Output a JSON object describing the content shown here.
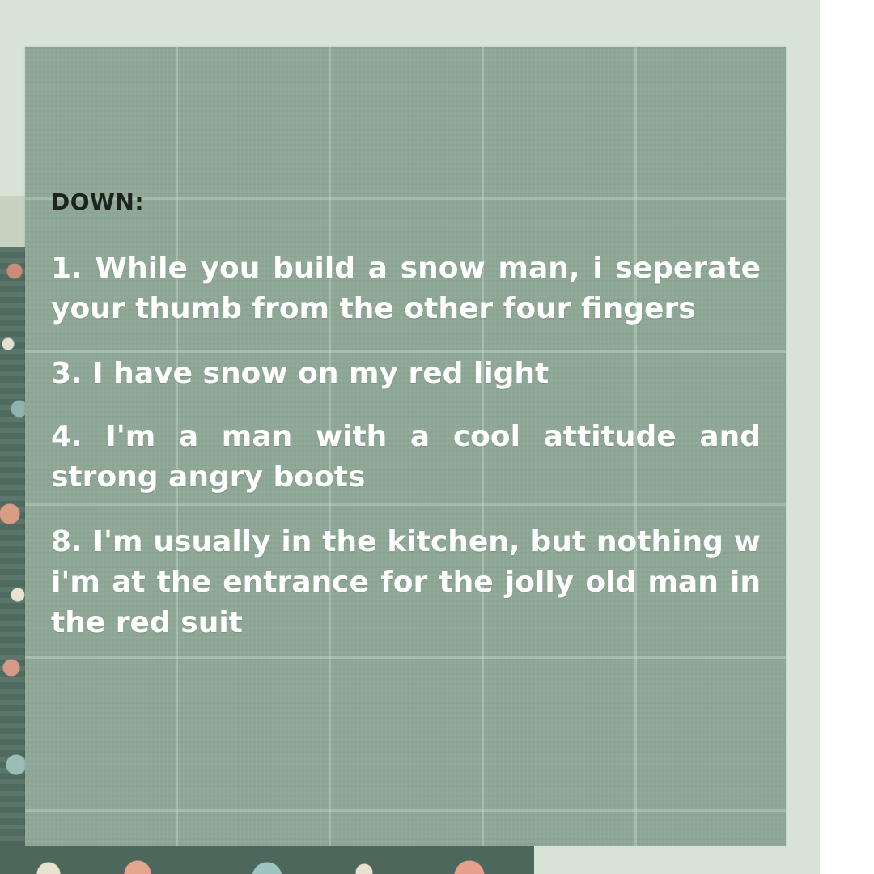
{
  "heading": "DOWN:",
  "clues": [
    "1. While you build a snow man, i seperate your thumb from the other four fingers",
    "3. I have snow on my red light",
    "4. I'm a man with a cool attitude and strong angry boots",
    "8. I'm usually in the kitchen, but nothing w i'm at the entrance for the jolly old man in the red suit"
  ],
  "colors": {
    "background": "#d6e3d6",
    "card": "#8fa896",
    "heading_text": "#1f231f",
    "clue_text": "#ffffff"
  }
}
